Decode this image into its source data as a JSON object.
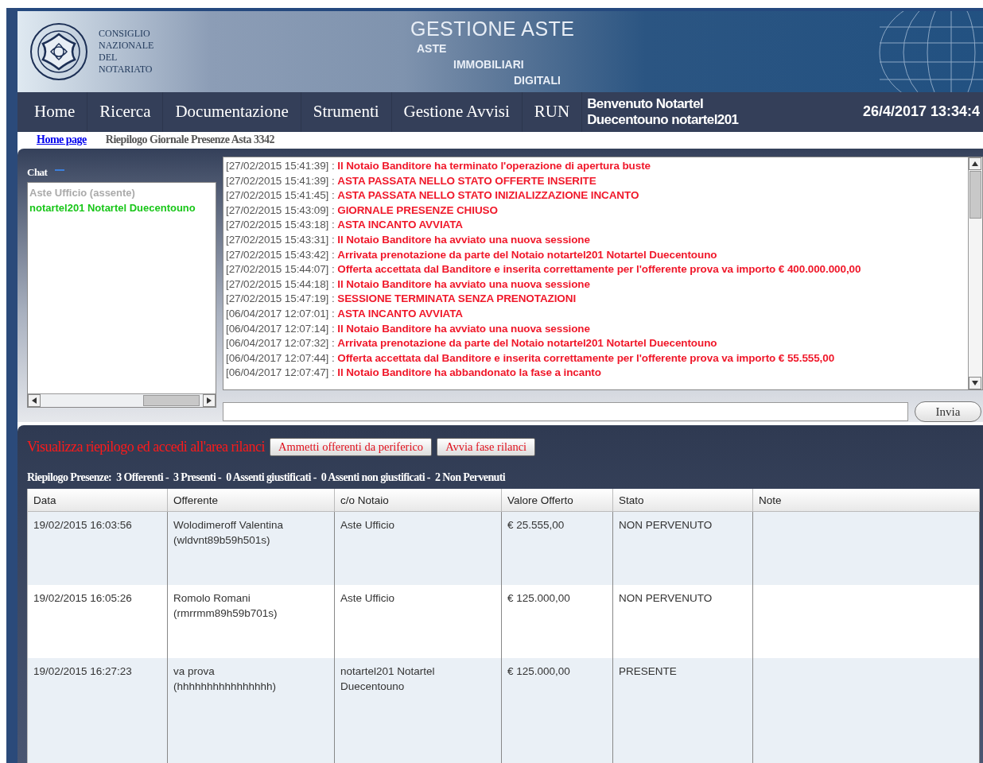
{
  "banner": {
    "org_lines": [
      "CONSIGLIO",
      "NAZIONALE",
      "DEL",
      "NOTARIATO"
    ],
    "title": "GESTIONE ASTE",
    "subtitle_lines": [
      "ASTE",
      "IMMOBILIARI",
      "DIGITALI"
    ]
  },
  "nav": {
    "items": [
      "Home",
      "Ricerca",
      "Documentazione",
      "Strumenti",
      "Gestione Avvisi",
      "RUN"
    ],
    "welcome": "Benvenuto Notartel Duecentouno notartel201",
    "datetime": "26/4/2017 13:34:4"
  },
  "breadcrumb": {
    "link": "Home page",
    "current": "Riepilogo Giornale Presenze Asta 3342"
  },
  "chat": {
    "title": "Chat",
    "users": [
      {
        "name": "Aste Ufficio (assente)",
        "present": false
      },
      {
        "name": "notartel201 Notartel Duecentouno",
        "present": true
      }
    ],
    "messages": [
      {
        "time": "[27/02/2015 15:41:39] :",
        "text": "Il Notaio Banditore ha terminato l'operazione di apertura buste"
      },
      {
        "time": "[27/02/2015 15:41:39] :",
        "text": "ASTA PASSATA NELLO STATO OFFERTE INSERITE"
      },
      {
        "time": "[27/02/2015 15:41:45] :",
        "text": "ASTA PASSATA NELLO STATO INIZIALIZZAZIONE INCANTO"
      },
      {
        "time": "[27/02/2015 15:43:09] :",
        "text": "GIORNALE PRESENZE CHIUSO"
      },
      {
        "time": "[27/02/2015 15:43:18] :",
        "text": "ASTA INCANTO AVVIATA"
      },
      {
        "time": "[27/02/2015 15:43:31] :",
        "text": "Il Notaio Banditore ha avviato una nuova sessione"
      },
      {
        "time": "[27/02/2015 15:43:42] :",
        "text": "Arrivata prenotazione da parte del Notaio notartel201 Notartel Duecentouno"
      },
      {
        "time": "[27/02/2015 15:44:07] :",
        "text": "Offerta accettata dal Banditore e inserita correttamente per l'offerente prova va importo € 400.000.000,00"
      },
      {
        "time": "[27/02/2015 15:44:18] :",
        "text": "Il Notaio Banditore ha avviato una nuova sessione"
      },
      {
        "time": "[27/02/2015 15:47:19] :",
        "text": "SESSIONE TERMINATA SENZA PRENOTAZIONI"
      },
      {
        "time": "[06/04/2017 12:07:01] :",
        "text": "ASTA INCANTO AVVIATA"
      },
      {
        "time": "[06/04/2017 12:07:14] :",
        "text": "Il Notaio Banditore ha avviato una nuova sessione"
      },
      {
        "time": "[06/04/2017 12:07:32] :",
        "text": "Arrivata prenotazione da parte del Notaio notartel201 Notartel Duecentouno"
      },
      {
        "time": "[06/04/2017 12:07:44] :",
        "text": "Offerta accettata dal Banditore e inserita correttamente per l'offerente prova va importo € 55.555,00"
      },
      {
        "time": "[06/04/2017 12:07:47] :",
        "text": "Il Notaio Banditore ha abbandonato la fase a incanto"
      }
    ],
    "send": "Invia"
  },
  "actions": {
    "link": "Visualizza riepilogo ed accedi all'area rilanci",
    "buttons": [
      "Ammetti offerenti da periferico",
      "Avvia fase rilanci"
    ]
  },
  "summary": {
    "label": "Riepilogo Presenze:",
    "counts": [
      "3 Offerenti -",
      "3 Presenti -",
      "0 Assenti giustificati -",
      "0 Assenti non giustificati -",
      "2 Non Pervenuti"
    ]
  },
  "table": {
    "columns": [
      "Data",
      "Offerente",
      "c/o Notaio",
      "Valore Offerto",
      "Stato",
      "Note"
    ],
    "rows": [
      [
        "19/02/2015 16:03:56",
        [
          "Wolodimeroff Valentina",
          "(wldvnt89b59h501s)"
        ],
        "Aste Ufficio",
        "€ 25.555,00",
        "NON PERVENUTO",
        ""
      ],
      [
        "19/02/2015 16:05:26",
        [
          "Romolo Romani",
          "(rmrrmm89h59b701s)"
        ],
        "Aste Ufficio",
        "€ 125.000,00",
        "NON PERVENUTO",
        ""
      ],
      [
        "19/02/2015 16:27:23",
        [
          "va prova",
          "(hhhhhhhhhhhhhhhh)"
        ],
        "notartel201 Notartel Duecentouno",
        "€ 125.000,00",
        "PRESENTE",
        ""
      ]
    ]
  }
}
